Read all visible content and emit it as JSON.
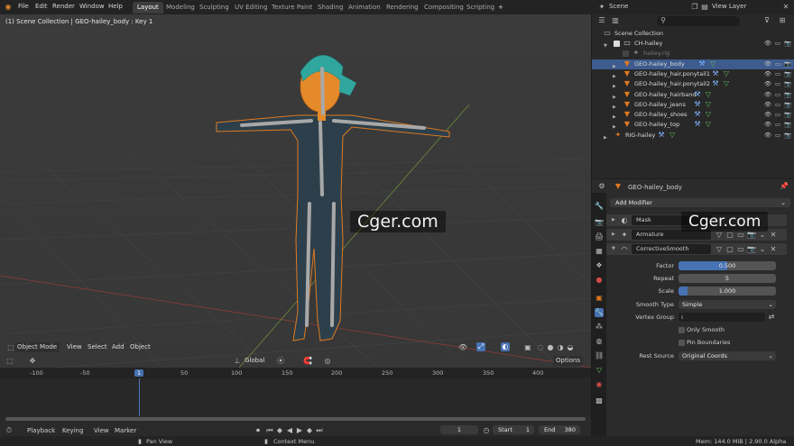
{
  "menu": [
    "File",
    "Edit",
    "Render",
    "Window",
    "Help"
  ],
  "workspaces": [
    "Layout",
    "Modeling",
    "Sculpting",
    "UV Editing",
    "Texture Paint",
    "Shading",
    "Animation",
    "Rendering",
    "Compositing",
    "Scripting"
  ],
  "active_workspace": "Layout",
  "add_workspace": "+",
  "scene": {
    "label": "Scene",
    "view_layer": "View Layer"
  },
  "viewport": {
    "overlay_text": "(1) Scene Collection | GEO-hailey_body : Key 1",
    "mode": "Object Mode",
    "menus": [
      "View",
      "Select",
      "Add",
      "Object"
    ],
    "transform_orientation": "Global",
    "options": "Options"
  },
  "outliner": {
    "root": "Scene Collection",
    "items": [
      {
        "label": "CH-hailey"
      },
      {
        "label": "hailey.rig"
      },
      {
        "label": "GEO-hailey_body"
      },
      {
        "label": "GEO-hailey_hair.ponytail1"
      },
      {
        "label": "GEO-hailey_hair.ponytail2"
      },
      {
        "label": "GEO-hailey_hairband"
      },
      {
        "label": "GEO-hailey_jeans"
      },
      {
        "label": "GEO-hailey_shoes"
      },
      {
        "label": "GEO-hailey_top"
      },
      {
        "label": "RIG-hailey"
      }
    ]
  },
  "properties": {
    "object_name": "GEO-hailey_body",
    "add_modifier": "Add Modifier",
    "modifiers": [
      "Mask",
      "Armature",
      "CorrectiveSmooth"
    ],
    "fields": {
      "factor_label": "Factor",
      "factor_value": "0.500",
      "factor_fill": 0.5,
      "repeat_label": "Repeat",
      "repeat_value": "5",
      "scale_label": "Scale",
      "scale_value": "1.000",
      "smooth_type_label": "Smooth Type",
      "smooth_type_value": "Simple",
      "vertex_group_label": "Vertex Group",
      "only_smooth": "Only Smooth",
      "pin_boundaries": "Pin Boundaries",
      "rest_source_label": "Rest Source",
      "rest_source_value": "Original Coords"
    }
  },
  "timeline": {
    "ticks": [
      "-100",
      "-50",
      "1",
      "50",
      "100",
      "150",
      "200",
      "250",
      "300",
      "350",
      "400"
    ],
    "current_frame": "1",
    "menus": [
      "Playback",
      "Keying",
      "View",
      "Marker"
    ],
    "frame_field": "1",
    "start_label": "Start",
    "start_value": "1",
    "end_label": "End",
    "end_value": "380"
  },
  "statusbar": {
    "pan": "Pan View",
    "context": "Context Menu",
    "mem": "Mem: 144.0 MiB | 2.90.0 Alpha"
  },
  "watermark": "Cger.com",
  "colors": {
    "accent": "#4772b3",
    "selection": "#3e5b8e",
    "object_orange": "#e07a1f"
  }
}
